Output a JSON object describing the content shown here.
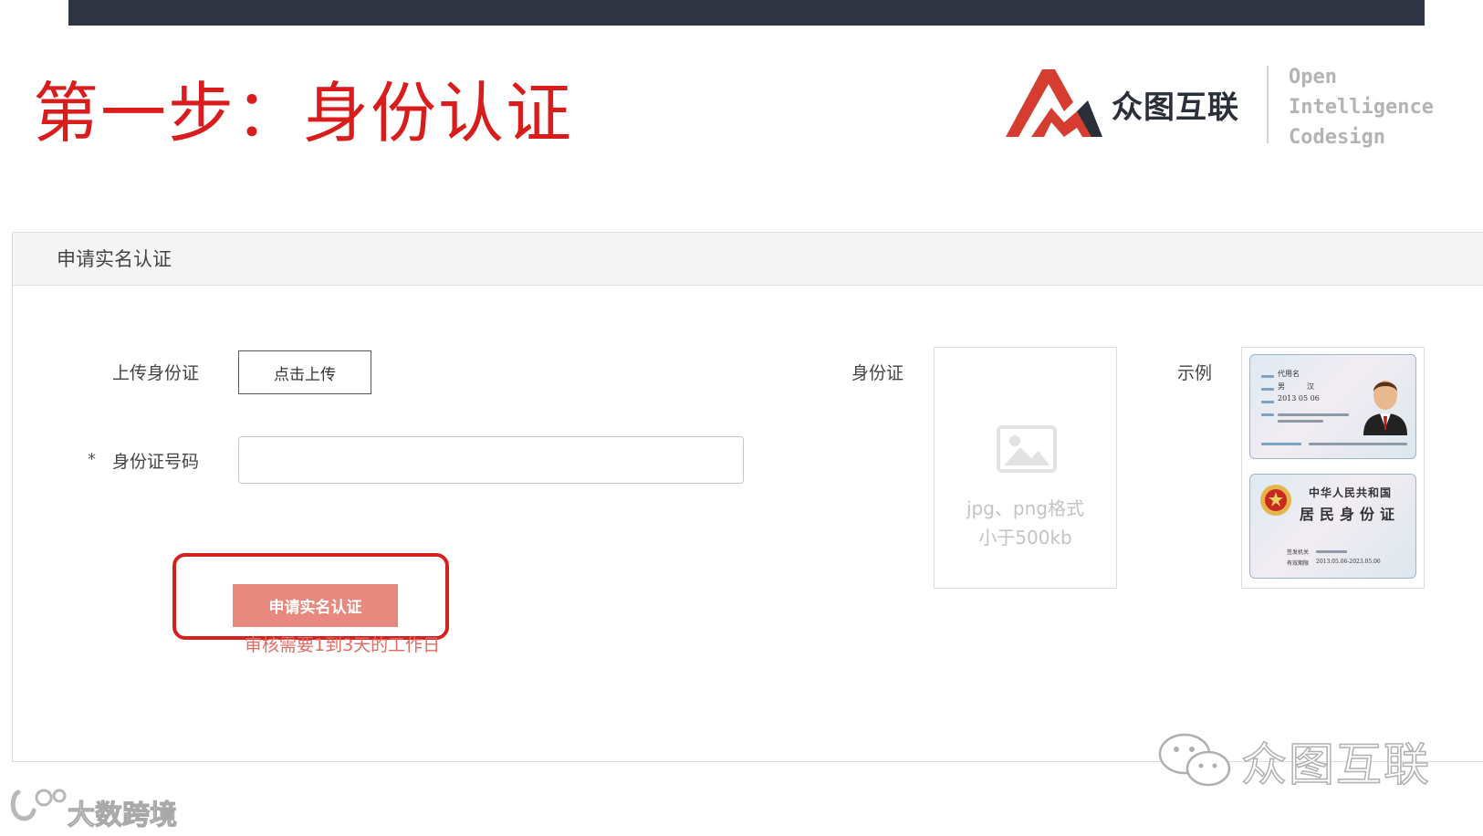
{
  "slide": {
    "title": "第一步：身份认证"
  },
  "logo": {
    "name_cn": "众图互联",
    "tagline_lines": [
      "Open",
      "Intelligence",
      "Codesign"
    ]
  },
  "panel": {
    "header": "申请实名认证"
  },
  "form": {
    "upload_label": "上传身份证",
    "upload_button": "点击上传",
    "required_mark": "*",
    "id_number_label": "身份证号码",
    "id_number_value": "",
    "submit_button": "申请实名认证",
    "review_note": "审核需要1到3天的工作日"
  },
  "preview": {
    "label": "身份证",
    "format_hint": "jpg、png格式",
    "size_hint": "小于500kb"
  },
  "example": {
    "label": "示例",
    "front_card": {
      "name_field": "代用名",
      "sex_field": "男",
      "nation_field": "汉",
      "birth_field": "2013 05 06"
    },
    "back_card": {
      "country": "中华人民共和国",
      "title": "居民身份证",
      "authority_label": "签发机关",
      "validity_label": "有效期限",
      "validity_value": "2013.05.06-2023.05.06"
    }
  },
  "watermarks": {
    "wechat_account": "众图互联",
    "source": "大数跨境"
  },
  "colors": {
    "accent_red": "#d91c1c",
    "button_fill": "#e8897f",
    "top_bar": "#2f3542"
  }
}
